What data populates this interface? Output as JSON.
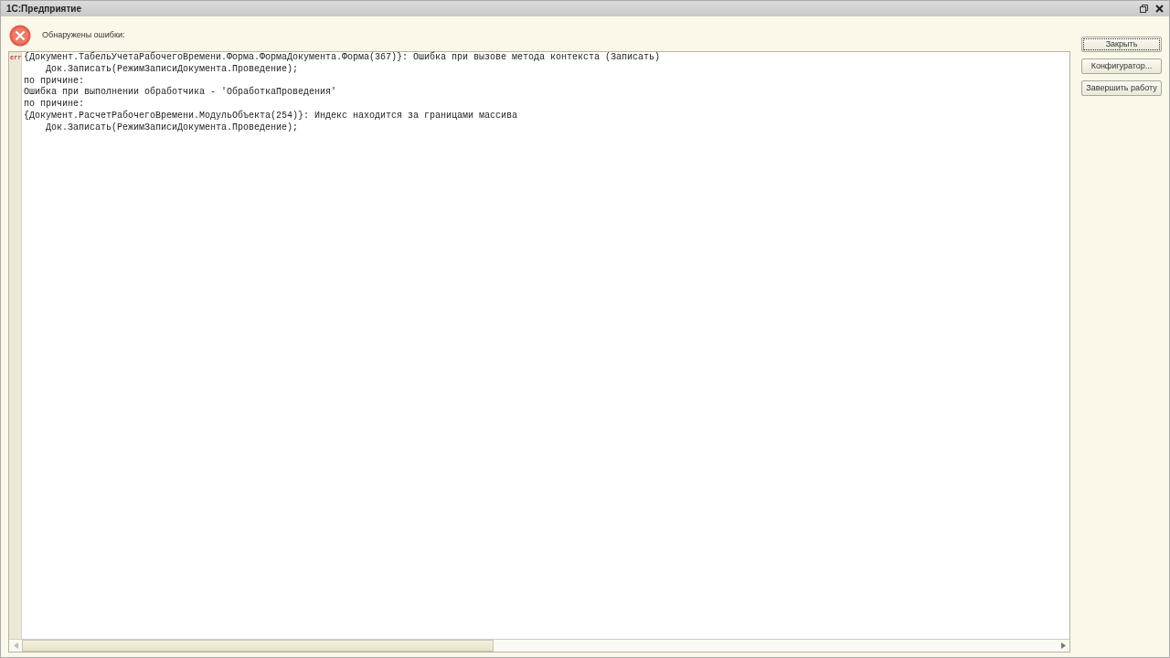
{
  "window": {
    "title": "1С:Предприятие"
  },
  "message": "Обнаружены ошибки:",
  "lines": [
    {
      "marker": "err",
      "text": "{Документ.ТабельУчетаРабочегоВремени.Форма.ФормаДокумента.Форма(367)}: Ошибка при вызове метода контекста (Записать)"
    },
    {
      "text": "    Док.Записать(РежимЗаписиДокумента.Проведение);"
    },
    {
      "text": "по причине:"
    },
    {
      "text": "Ошибка при выполнении обработчика - 'ОбработкаПроведения'"
    },
    {
      "text": "по причине:"
    },
    {
      "text": "{Документ.РасчетРабочегоВремени.МодульОбъекта(254)}: Индекс находится за границами массива"
    },
    {
      "text": "    Док.Записать(РежимЗаписиДокумента.Проведение);"
    }
  ],
  "buttons": [
    {
      "label": "Закрыть",
      "focused": true
    },
    {
      "label": "Конфигуратор...",
      "focused": false
    },
    {
      "label": "Завершить работу",
      "focused": false
    }
  ]
}
